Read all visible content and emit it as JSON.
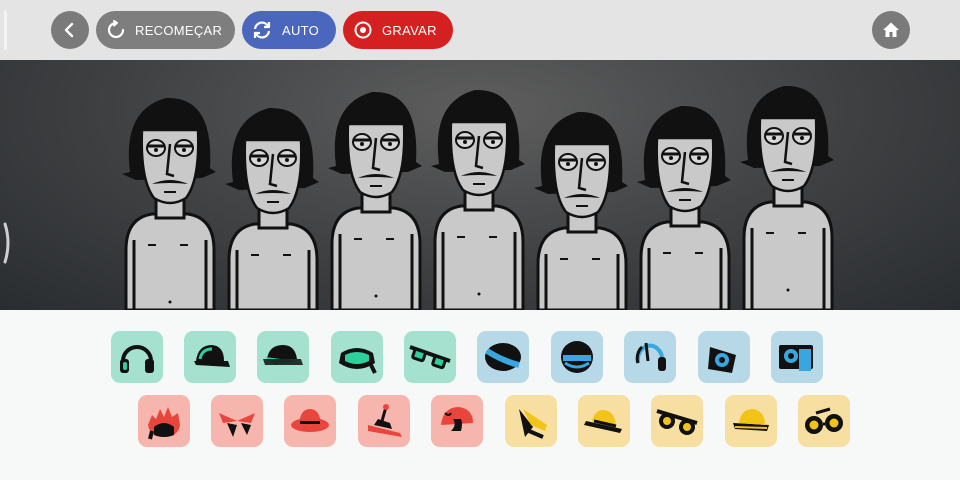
{
  "topbar": {
    "back_icon": "chevron-left-icon",
    "restart_label": "RECOMEÇAR",
    "restart_icon": "restart-icon",
    "auto_label": "AUTO",
    "auto_icon": "refresh-icon",
    "record_label": "GRAVAR",
    "record_icon": "record-icon",
    "home_icon": "home-icon"
  },
  "stage": {
    "character_count": 7
  },
  "palette": {
    "row1": [
      {
        "icon": "headphones-icon",
        "color": "#a4e2cf"
      },
      {
        "icon": "cap-icon",
        "color": "#a4e2cf"
      },
      {
        "icon": "cap-side-icon",
        "color": "#a4e2cf"
      },
      {
        "icon": "goggles-icon",
        "color": "#a4e2cf"
      },
      {
        "icon": "glasses-icon",
        "color": "#a4e2cf"
      },
      {
        "icon": "visor-icon",
        "color": "#b7d8e6"
      },
      {
        "icon": "helmet-icon",
        "color": "#b7d8e6"
      },
      {
        "icon": "headset-icon",
        "color": "#b7d8e6"
      },
      {
        "icon": "speaker-icon",
        "color": "#b7d8e6"
      },
      {
        "icon": "radio-icon",
        "color": "#b7d8e6"
      }
    ],
    "row2": [
      {
        "icon": "spiky-hair-icon",
        "color": "#f6b6ae"
      },
      {
        "icon": "bow-icon",
        "color": "#f6b6ae"
      },
      {
        "icon": "fedora-icon",
        "color": "#f6b6ae"
      },
      {
        "icon": "antenna-hat-icon",
        "color": "#f6b6ae"
      },
      {
        "icon": "beanie-icon",
        "color": "#f6b6ae"
      },
      {
        "icon": "feather-icon",
        "color": "#f7dfa1"
      },
      {
        "icon": "straw-hat-icon",
        "color": "#f7dfa1"
      },
      {
        "icon": "sunglasses-icon",
        "color": "#f7dfa1"
      },
      {
        "icon": "bucket-hat-icon",
        "color": "#f7dfa1"
      },
      {
        "icon": "round-glasses-icon",
        "color": "#f7dfa1"
      }
    ]
  }
}
